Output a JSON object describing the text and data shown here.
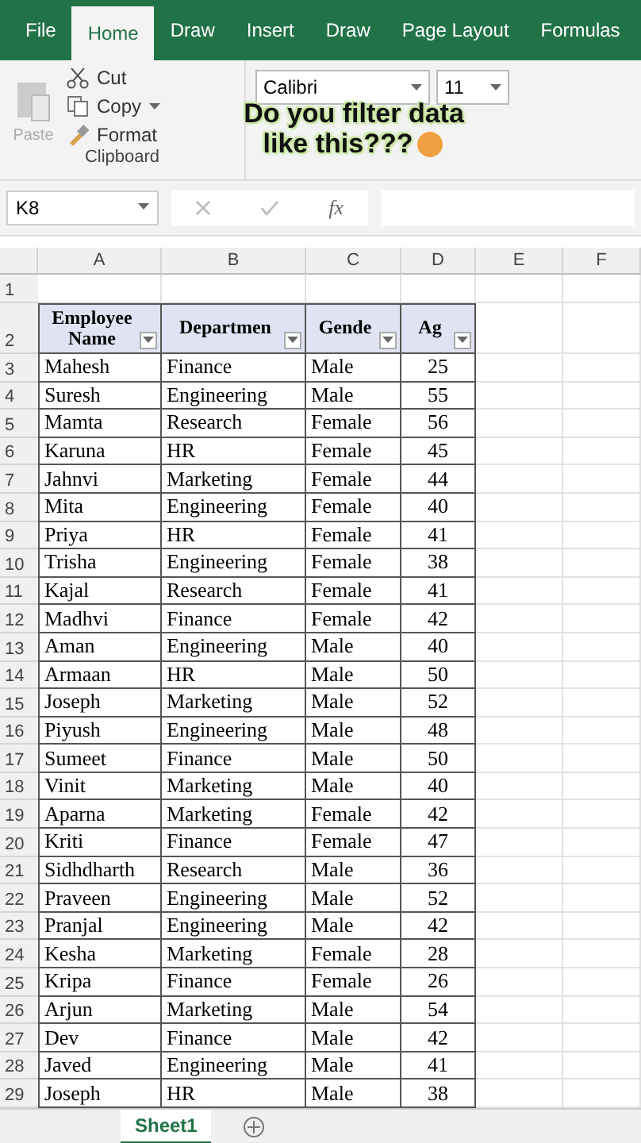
{
  "menu_tabs": [
    {
      "label": "File",
      "selected": false
    },
    {
      "label": "Home",
      "selected": true
    },
    {
      "label": "Draw",
      "selected": false
    },
    {
      "label": "Insert",
      "selected": false
    },
    {
      "label": "Draw",
      "selected": false
    },
    {
      "label": "Page Layout",
      "selected": false
    },
    {
      "label": "Formulas",
      "selected": false
    }
  ],
  "ribbon": {
    "paste": "Paste",
    "cut": "Cut",
    "copy": "Copy",
    "format_painter": "Format",
    "clipboard_label": "Clipboard",
    "font_name": "Calibri",
    "font_size": "11"
  },
  "caption": {
    "line_1": "Do you filter data",
    "line_2": "like this???"
  },
  "formula_bar": {
    "name_box": "K8",
    "fx": "fx"
  },
  "columns": [
    "A",
    "B",
    "C",
    "D",
    "E",
    "F"
  ],
  "row_numbers": [
    "1",
    "2",
    "3",
    "4",
    "5",
    "6",
    "7",
    "8",
    "9",
    "10",
    "11",
    "12",
    "13",
    "14",
    "15",
    "16",
    "17",
    "18",
    "19",
    "20",
    "21",
    "22",
    "23",
    "24",
    "25",
    "26",
    "27",
    "28",
    "29"
  ],
  "table": {
    "headers": [
      "Employee Name",
      "Departmen",
      "Gende",
      "Ag"
    ],
    "rows": [
      [
        "Mahesh",
        "Finance",
        "Male",
        "25"
      ],
      [
        "Suresh",
        "Engineering",
        "Male",
        "55"
      ],
      [
        "Mamta",
        "Research",
        "Female",
        "56"
      ],
      [
        "Karuna",
        "HR",
        "Female",
        "45"
      ],
      [
        "Jahnvi",
        "Marketing",
        "Female",
        "44"
      ],
      [
        "Mita",
        "Engineering",
        "Female",
        "40"
      ],
      [
        "Priya",
        "HR",
        "Female",
        "41"
      ],
      [
        "Trisha",
        "Engineering",
        "Female",
        "38"
      ],
      [
        "Kajal",
        "Research",
        "Female",
        "41"
      ],
      [
        "Madhvi",
        "Finance",
        "Female",
        "42"
      ],
      [
        "Aman",
        "Engineering",
        "Male",
        "40"
      ],
      [
        "Armaan",
        "HR",
        "Male",
        "50"
      ],
      [
        "Joseph",
        "Marketing",
        "Male",
        "52"
      ],
      [
        "Piyush",
        "Engineering",
        "Male",
        "48"
      ],
      [
        "Sumeet",
        "Finance",
        "Male",
        "50"
      ],
      [
        "Vinit",
        "Marketing",
        "Male",
        "40"
      ],
      [
        "Aparna",
        "Marketing",
        "Female",
        "42"
      ],
      [
        "Kriti",
        "Finance",
        "Female",
        "47"
      ],
      [
        "Sidhdharth",
        "Research",
        "Male",
        "36"
      ],
      [
        "Praveen",
        "Engineering",
        "Male",
        "52"
      ],
      [
        "Pranjal",
        "Engineering",
        "Male",
        "42"
      ],
      [
        "Kesha",
        "Marketing",
        "Female",
        "28"
      ],
      [
        "Kripa",
        "Finance",
        "Female",
        "26"
      ],
      [
        "Arjun",
        "Marketing",
        "Male",
        "54"
      ],
      [
        "Dev",
        "Finance",
        "Male",
        "42"
      ],
      [
        "Javed",
        "Engineering",
        "Male",
        "41"
      ],
      [
        "Joseph",
        "HR",
        "Male",
        "38"
      ]
    ]
  },
  "sheet_tabs": [
    {
      "label": "Sheet1",
      "selected": true
    }
  ]
}
